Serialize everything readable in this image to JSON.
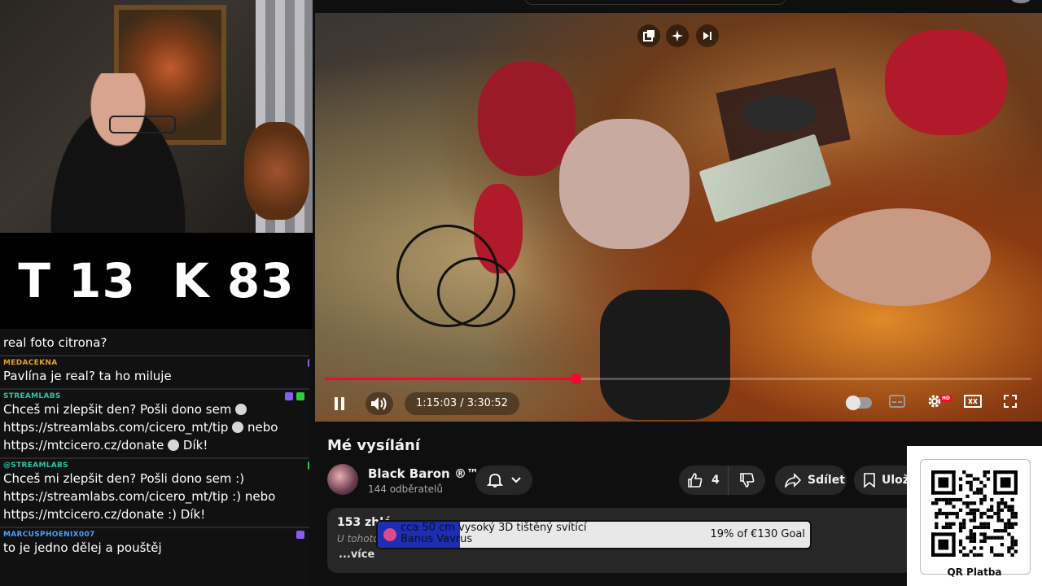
{
  "score": {
    "t": "T 13",
    "k": "K 83"
  },
  "chat": [
    {
      "user": "",
      "user_color": "#bbbbbb",
      "text": "real foto citrona?"
    },
    {
      "user": "MEDACEKNA",
      "user_color": "#e0a030",
      "text": "Pavlína je real? ta ho miluje"
    },
    {
      "user": "STREAMLABS",
      "user_color": "#31c3a2",
      "text_1": "Chceš mi zlepšit den? Pošli dono sem",
      "text_2": "https://streamlabs.com/cicero_mt/tip",
      "text_3": "nebo",
      "text_4": "https://mtcicero.cz/donate",
      "text_5": "Dík!"
    },
    {
      "user": "@STREAMLABS",
      "user_color": "#31c3a2",
      "text_1": "Chceš mi zlepšit den? Pošli dono sem :)",
      "text_2": "https://streamlabs.com/cicero_mt/tip :) nebo",
      "text_3": "https://mtcicero.cz/donate :) Dík!"
    },
    {
      "user": "MARCUSPHOENIX007",
      "user_color": "#4aa0ff",
      "text": "to je jedno dělej a pouštěj"
    }
  ],
  "player": {
    "time": "1:15:03 / 3:30:52",
    "progress": 0.355,
    "quality_badge": "HD",
    "colors": {
      "progress": "#ff0033"
    }
  },
  "video": {
    "title": "Mé vysílání",
    "channel_name": "Black Baron ®™",
    "subscribers": "144 odběratelů",
    "likes": "4",
    "share": "Sdílet",
    "save": "Ulož",
    "views": "153 zhlé",
    "desc_line": "U tohoto",
    "desc_line_tail": "s",
    "more": "...více"
  },
  "goal": {
    "line1": "cca 50 cm vysoký 3D tištěný svítící",
    "line2": "Banus Vavrus",
    "amount": "19% of €130 Goal",
    "progress": 0.19
  },
  "qr": {
    "label": "QR Platba"
  }
}
